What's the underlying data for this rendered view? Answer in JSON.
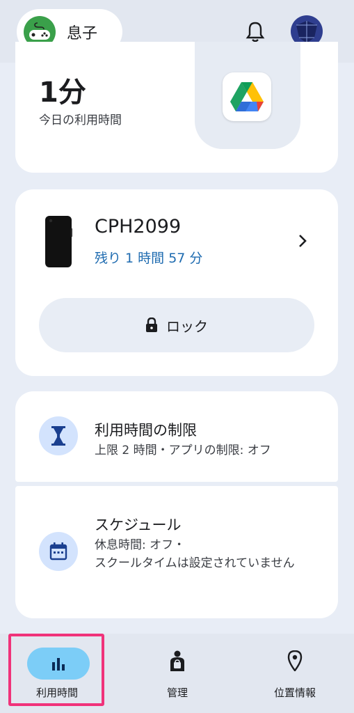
{
  "header": {
    "child_name": "息子",
    "icons": {
      "child_avatar": "gamepad-icon",
      "notifications": "bell-icon",
      "parent_avatar": "avatar"
    }
  },
  "usage_card": {
    "today_value": "1分",
    "today_label": "今日の利用時間",
    "app_icon": "google-drive-icon"
  },
  "device_card": {
    "device_name": "CPH2099",
    "remaining": "残り 1 時間 57 分",
    "lock_label": "ロック"
  },
  "limits": {
    "title": "利用時間の制限",
    "subtitle": "上限 2 時間・アプリの制限: オフ"
  },
  "schedule": {
    "title": "スケジュール",
    "line1": "休息時間: オフ・",
    "line2": "スクールタイムは設定されていません"
  },
  "bottom_nav": [
    {
      "label": "利用時間",
      "icon": "bar-chart-icon",
      "active": true
    },
    {
      "label": "管理",
      "icon": "manage-person-icon",
      "active": false
    },
    {
      "label": "位置情報",
      "icon": "location-pin-icon",
      "active": false
    }
  ],
  "colors": {
    "accent_text": "#1e6bb0",
    "nav_active": "#7ccdf7",
    "highlight": "#f0337a"
  }
}
